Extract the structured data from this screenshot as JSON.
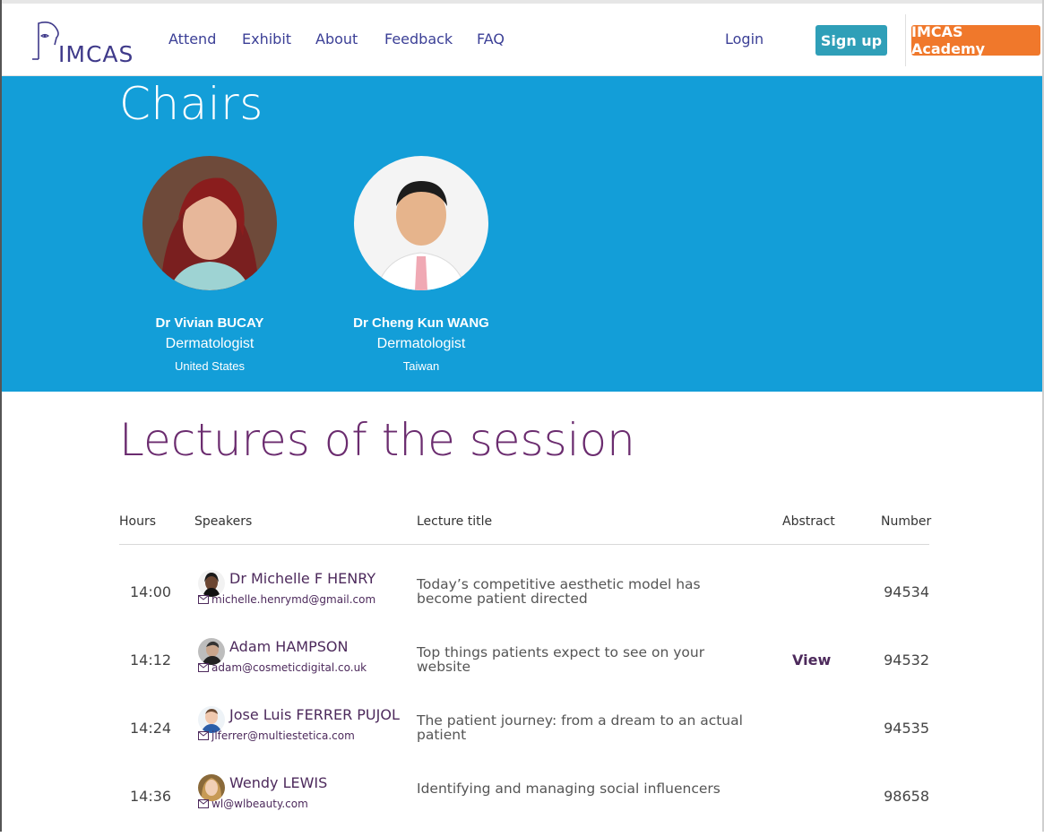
{
  "header": {
    "logo_text": "IMCAS",
    "nav": [
      "Attend",
      "Exhibit",
      "About",
      "Feedback",
      "FAQ"
    ],
    "login": "Login",
    "signup": "Sign up",
    "academy": "IMCAS Academy"
  },
  "chairs": {
    "title": "Chairs",
    "people": [
      {
        "name": "Dr Vivian BUCAY",
        "specialty": "Dermatologist",
        "country": "United States"
      },
      {
        "name": "Dr Cheng Kun WANG",
        "specialty": "Dermatologist",
        "country": "Taiwan"
      }
    ]
  },
  "lectures": {
    "title": "Lectures of the session",
    "columns": {
      "hours": "Hours",
      "speakers": "Speakers",
      "lecture_title": "Lecture title",
      "abstract": "Abstract",
      "number": "Number"
    },
    "rows": [
      {
        "hour": "14:00",
        "speaker": "Dr Michelle F HENRY",
        "email": "michelle.henrymd@gmail.com",
        "title": "Today’s competitive aesthetic model has become patient directed",
        "abstract": "",
        "number": "94534"
      },
      {
        "hour": "14:12",
        "speaker": "Adam HAMPSON",
        "email": "adam@cosmeticdigital.co.uk",
        "title": "Top things patients expect to see on your website",
        "abstract": "View",
        "number": "94532"
      },
      {
        "hour": "14:24",
        "speaker": "Jose Luis FERRER PUJOL",
        "email": "jlferrer@multiestetica.com",
        "title": "The patient journey: from a dream to an actual patient",
        "abstract": "",
        "number": "94535"
      },
      {
        "hour": "14:36",
        "speaker": "Wendy LEWIS",
        "email": "wl@wlbeauty.com",
        "title": "Identifying and managing social influencers",
        "abstract": "",
        "number": "98658"
      }
    ]
  },
  "colors": {
    "brand_blue": "#139ed8",
    "nav_text": "#3b3f96",
    "signup": "#2f9fb8",
    "academy": "#f0782b",
    "lecture_purple": "#6b2c6f"
  }
}
